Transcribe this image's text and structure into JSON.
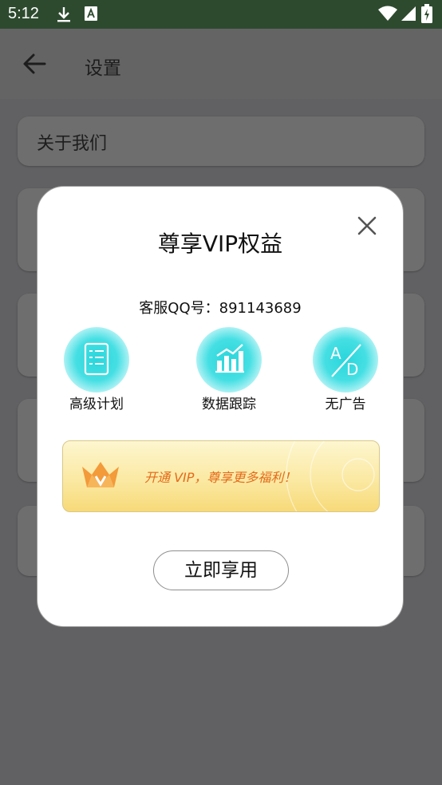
{
  "status_bar": {
    "time": "5:12"
  },
  "app_bar": {
    "title": "设置"
  },
  "settings": {
    "items": [
      {
        "label": "关于我们"
      }
    ]
  },
  "dialog": {
    "title": "尊享VIP权益",
    "qq_line": "客服QQ号：891143689",
    "features": [
      {
        "label": "高级计划",
        "icon": "plan-checklist-icon"
      },
      {
        "label": "数据跟踪",
        "icon": "bar-chart-icon"
      },
      {
        "label": "无广告",
        "icon": "no-ads-icon"
      }
    ],
    "banner_text": "开通 VIP，尊享更多福利！",
    "action_label": "立即享用"
  },
  "colors": {
    "accent_cyan": "#2fd8de",
    "banner_orange": "#e46a1a",
    "status_bar": "#2d4a2f"
  }
}
